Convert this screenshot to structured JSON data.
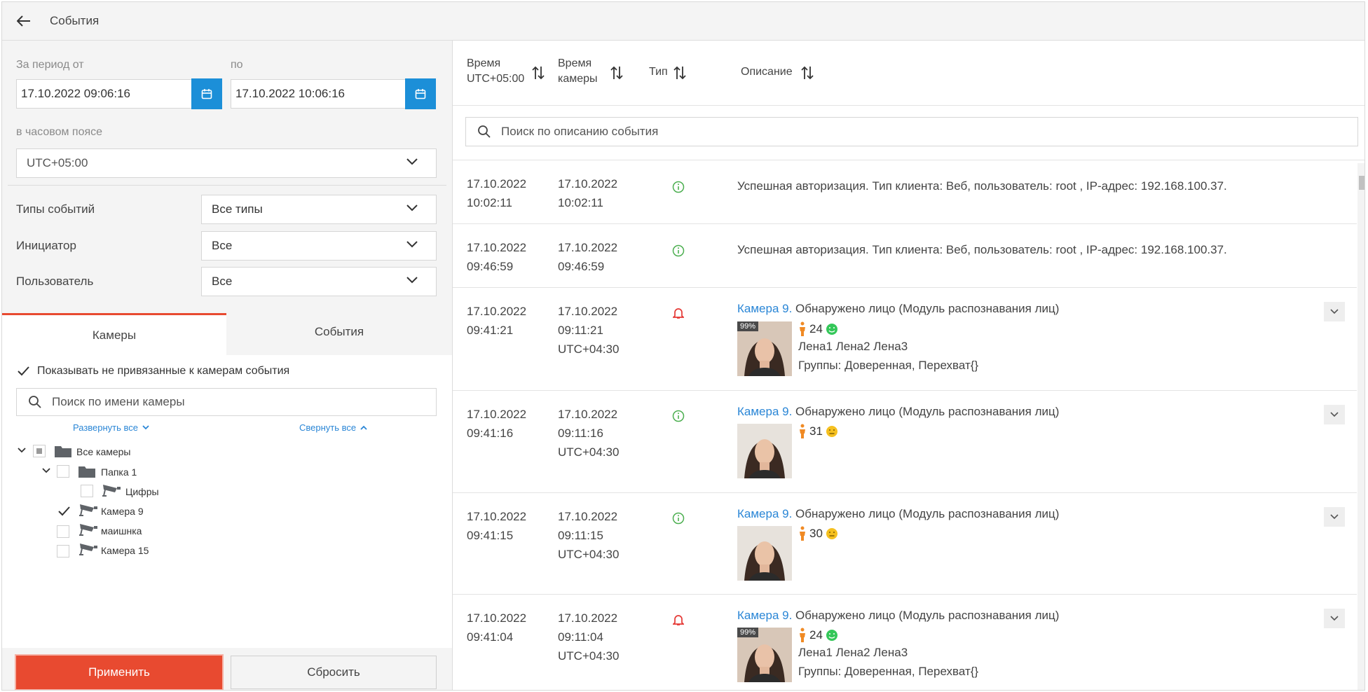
{
  "header": {
    "title": "События"
  },
  "filters": {
    "period_from_label": "За период от",
    "period_to_label": "по",
    "date_from": "17.10.2022 09:06:16",
    "date_to": "17.10.2022 10:06:16",
    "timezone_label": "в часовом поясе",
    "timezone": "UTC+05:00",
    "event_types_label": "Типы событий",
    "event_types_value": "Все типы",
    "initiator_label": "Инициатор",
    "initiator_value": "Все",
    "user_label": "Пользователь",
    "user_value": "Все"
  },
  "tabs": {
    "cameras": "Камеры",
    "events": "События"
  },
  "camera_panel": {
    "show_unbound_label": "Показывать не привязанные к камерам события",
    "search_placeholder": "Поиск по имени камеры",
    "expand_all": "Развернуть все",
    "collapse_all": "Свернуть все",
    "tree": {
      "all_cameras": "Все камеры",
      "folder1": "Папка 1",
      "cam_digits": "Цифры",
      "cam9": "Камера 9",
      "cam_car": "маишнка",
      "cam15": "Камера 15"
    }
  },
  "buttons": {
    "apply": "Применить",
    "reset": "Сбросить"
  },
  "table": {
    "col_time_line1": "Время",
    "col_time_line2": "UTC+05:00",
    "col_camtime_line1": "Время",
    "col_camtime_line2": "камеры",
    "col_type": "Тип",
    "col_desc": "Описание",
    "search_placeholder": "Поиск по описанию события"
  },
  "events": [
    {
      "t1": "17.10.2022",
      "t2": "10:02:11",
      "c1": "17.10.2022",
      "c2": "10:02:11",
      "c3": "",
      "type": "info",
      "desc": "Успешная авторизация. Тип клиента: Веб, пользователь: root , IP-адрес: 192.168.100.37."
    },
    {
      "t1": "17.10.2022",
      "t2": "09:46:59",
      "c1": "17.10.2022",
      "c2": "09:46:59",
      "c3": "",
      "type": "info",
      "desc": "Успешная авторизация. Тип клиента: Веб, пользователь: root , IP-адрес: 192.168.100.37."
    },
    {
      "t1": "17.10.2022",
      "t2": "09:41:21",
      "c1": "17.10.2022",
      "c2": "09:11:21",
      "c3": "UTC+04:30",
      "type": "alarm",
      "camera": "Камера 9.",
      "desc": "Обнаружено лицо (Модуль распознавания лиц)",
      "badge": "99%",
      "age": "24",
      "names": "Лена1 Лена2 Лена3",
      "groups": "Группы: Доверенная, Перехват{}"
    },
    {
      "t1": "17.10.2022",
      "t2": "09:41:16",
      "c1": "17.10.2022",
      "c2": "09:11:16",
      "c3": "UTC+04:30",
      "type": "info",
      "camera": "Камера 9.",
      "desc": "Обнаружено лицо (Модуль распознавания лиц)",
      "age": "31"
    },
    {
      "t1": "17.10.2022",
      "t2": "09:41:15",
      "c1": "17.10.2022",
      "c2": "09:11:15",
      "c3": "UTC+04:30",
      "type": "info",
      "camera": "Камера 9.",
      "desc": "Обнаружено лицо (Модуль распознавания лиц)",
      "age": "30"
    },
    {
      "t1": "17.10.2022",
      "t2": "09:41:04",
      "c1": "17.10.2022",
      "c2": "09:11:04",
      "c3": "UTC+04:30",
      "type": "alarm",
      "camera": "Камера 9.",
      "desc": "Обнаружено лицо (Модуль распознавания лиц)",
      "badge": "99%",
      "age": "24",
      "names": "Лена1 Лена2 Лена3",
      "groups": "Группы: Доверенная, Перехват{}"
    }
  ],
  "colors": {
    "accent_red": "#e84a30",
    "accent_blue": "#1c8fd8",
    "link": "#2a86d6",
    "info_green": "#4caf50",
    "alarm_red": "#e53935",
    "smile_green": "#34c759",
    "smile_yellow": "#f5c020",
    "person_orange": "#f08a24"
  },
  "icons": [
    "back-arrow-icon",
    "calendar-icon",
    "chevron-down-icon",
    "sort-icon",
    "search-icon",
    "info-icon",
    "bell-icon",
    "folder-icon",
    "camera-icon",
    "person-icon",
    "smile-icon",
    "neutral-face-icon"
  ]
}
